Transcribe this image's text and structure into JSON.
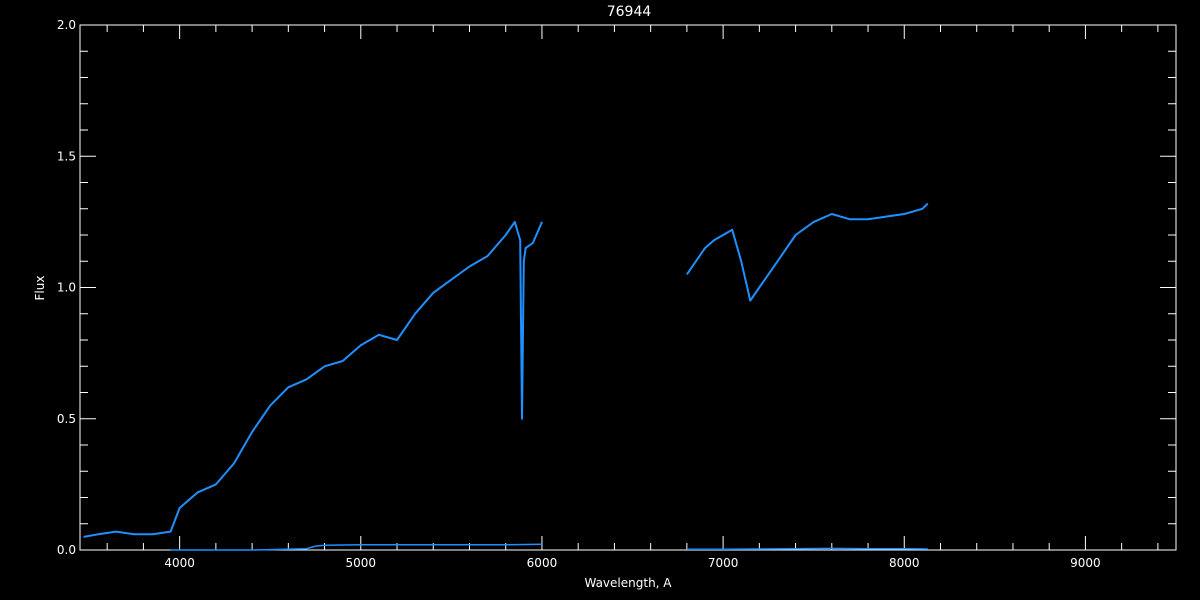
{
  "chart_data": {
    "type": "line",
    "title": "76944",
    "xlabel": "Wavelength, A",
    "ylabel": "Flux",
    "xlim": [
      3450,
      9500
    ],
    "ylim": [
      0.0,
      2.0
    ],
    "x_ticks": [
      4000,
      5000,
      6000,
      7000,
      8000,
      9000
    ],
    "x_tick_labels": [
      "4000",
      "5000",
      "6000",
      "7000",
      "8000",
      "9000"
    ],
    "y_ticks": [
      0.0,
      0.5,
      1.0,
      1.5,
      2.0
    ],
    "y_tick_labels": [
      "0.0",
      "0.5",
      "1.0",
      "1.5",
      "2.0"
    ],
    "grid": false,
    "background": "#000000",
    "foreground": "#ffffff",
    "series": [
      {
        "color": "#1e90ff",
        "segments": [
          {
            "x": [
              3470,
              3550,
              3650,
              3750,
              3850,
              3950,
              4000,
              4100,
              4200,
              4300,
              4400,
              4500,
              4600,
              4700,
              4800,
              4900,
              5000,
              5100,
              5200,
              5300,
              5400,
              5500,
              5600,
              5700,
              5800,
              5850,
              5880,
              5890,
              5900,
              5910,
              5950,
              6000
            ],
            "y": [
              0.05,
              0.06,
              0.07,
              0.06,
              0.06,
              0.07,
              0.16,
              0.22,
              0.25,
              0.33,
              0.45,
              0.55,
              0.62,
              0.65,
              0.7,
              0.72,
              0.78,
              0.82,
              0.8,
              0.9,
              0.98,
              1.03,
              1.08,
              1.12,
              1.2,
              1.25,
              1.18,
              0.5,
              1.1,
              1.15,
              1.17,
              1.25
            ]
          },
          {
            "x": [
              6800,
              6850,
              6900,
              6950,
              7000,
              7050,
              7100,
              7150,
              7200,
              7300,
              7400,
              7500,
              7600,
              7700,
              7800,
              7900,
              8000,
              8100,
              8130
            ],
            "y": [
              1.05,
              1.1,
              1.15,
              1.18,
              1.2,
              1.22,
              1.1,
              0.95,
              1.0,
              1.1,
              1.2,
              1.25,
              1.28,
              1.26,
              1.26,
              1.27,
              1.28,
              1.3,
              1.32
            ]
          }
        ]
      },
      {
        "color": "#1e90ff",
        "segments": [
          {
            "x": [
              3950,
              4400,
              4700,
              4750,
              4800,
              5000,
              5200,
              5400,
              5600,
              5800,
              6000
            ],
            "y": [
              0.0,
              0.0,
              0.005,
              0.015,
              0.018,
              0.02,
              0.02,
              0.02,
              0.02,
              0.02,
              0.022
            ]
          },
          {
            "x": [
              6800,
              7000,
              7200,
              7400,
              7600,
              7800,
              8000,
              8130
            ],
            "y": [
              0.003,
              0.003,
              0.004,
              0.005,
              0.006,
              0.005,
              0.005,
              0.004
            ]
          }
        ]
      }
    ]
  }
}
